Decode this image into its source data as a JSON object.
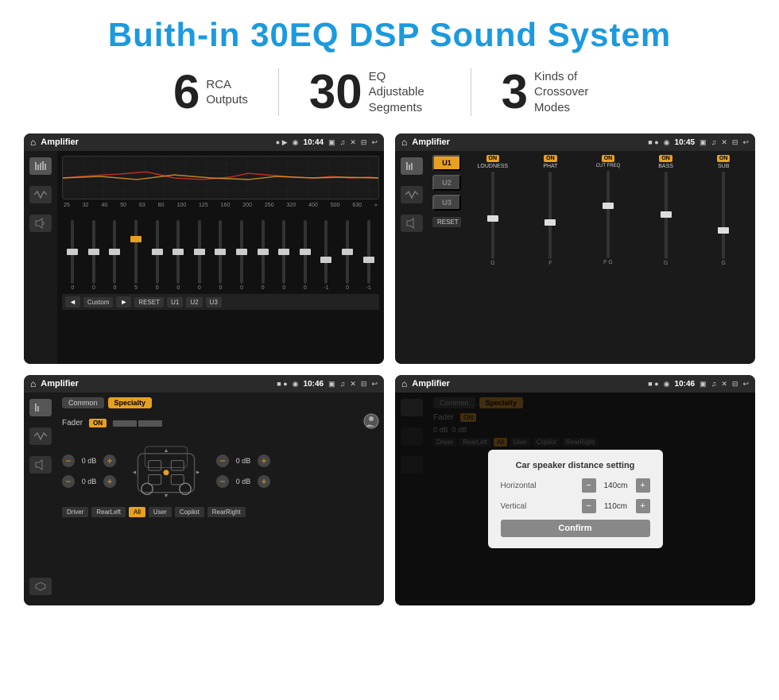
{
  "page": {
    "title": "Buith-in 30EQ DSP Sound System"
  },
  "stats": [
    {
      "number": "6",
      "label": "RCA\nOutputs"
    },
    {
      "number": "30",
      "label": "EQ Adjustable\nSegments"
    },
    {
      "number": "3",
      "label": "Kinds of\nCrossover Modes"
    }
  ],
  "screens": [
    {
      "id": "eq-screen",
      "time": "10:44",
      "title": "Amplifier",
      "type": "eq",
      "freq_labels": [
        "25",
        "32",
        "40",
        "50",
        "63",
        "80",
        "100",
        "125",
        "160",
        "200",
        "250",
        "320",
        "400",
        "500",
        "630"
      ],
      "slider_values": [
        "0",
        "0",
        "0",
        "5",
        "0",
        "0",
        "0",
        "0",
        "0",
        "0",
        "0",
        "0",
        "-1",
        "0",
        "-1"
      ],
      "slider_positions": [
        50,
        50,
        50,
        30,
        50,
        50,
        50,
        50,
        50,
        50,
        50,
        50,
        65,
        50,
        65
      ],
      "buttons": [
        "◄",
        "Custom",
        "►",
        "RESET",
        "U1",
        "U2",
        "U3"
      ]
    },
    {
      "id": "crossover-screen",
      "time": "10:45",
      "title": "Amplifier",
      "type": "crossover",
      "presets": [
        "U1",
        "U2",
        "U3"
      ],
      "channels": [
        {
          "name": "LOUDNESS",
          "on": true
        },
        {
          "name": "PHAT",
          "on": true
        },
        {
          "name": "CUT FREQ",
          "on": true
        },
        {
          "name": "BASS",
          "on": true
        },
        {
          "name": "SUB",
          "on": true
        }
      ]
    },
    {
      "id": "fader-screen",
      "time": "10:46",
      "title": "Amplifier",
      "type": "fader",
      "tabs": [
        "Common",
        "Specialty"
      ],
      "fader_label": "Fader",
      "fader_on": "ON",
      "db_values": [
        "0 dB",
        "0 dB",
        "0 dB",
        "0 dB"
      ],
      "bottom_btns": [
        "Driver",
        "RearLeft",
        "All",
        "User",
        "Copilot",
        "RearRight"
      ]
    },
    {
      "id": "dialog-screen",
      "time": "10:46",
      "title": "Amplifier",
      "type": "dialog",
      "dialog": {
        "title": "Car speaker distance setting",
        "horizontal_label": "Horizontal",
        "horizontal_value": "140cm",
        "vertical_label": "Vertical",
        "vertical_value": "110cm",
        "confirm_label": "Confirm"
      },
      "tabs": [
        "Common",
        "Specialty"
      ],
      "db_values": [
        "0 dB",
        "0 dB"
      ]
    }
  ],
  "icons": {
    "home": "⌂",
    "back": "↩",
    "location": "◉",
    "camera": "📷",
    "volume": "🔊",
    "close": "✕",
    "minimize": "─",
    "eq_icon": "≋",
    "wave_icon": "〰",
    "speaker_icon": "◈",
    "plus": "+",
    "minus": "−",
    "arrow_left": "◄",
    "arrow_right": "►",
    "arrow_up": "▲",
    "arrow_down": "▼",
    "user": "👤",
    "dots": "●●"
  }
}
